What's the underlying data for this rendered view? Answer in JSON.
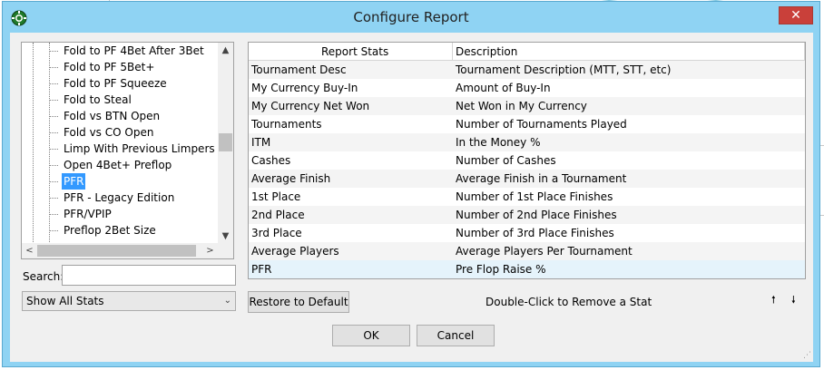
{
  "window": {
    "title": "Configure Report",
    "close_label": "✕"
  },
  "tree": {
    "items": [
      {
        "label": "Fold to PF 4Bet After 3Bet",
        "selected": false
      },
      {
        "label": "Fold to PF 5Bet+",
        "selected": false
      },
      {
        "label": "Fold to PF Squeeze",
        "selected": false
      },
      {
        "label": "Fold to Steal",
        "selected": false
      },
      {
        "label": "Fold vs BTN Open",
        "selected": false
      },
      {
        "label": "Fold vs CO Open",
        "selected": false
      },
      {
        "label": "Limp With Previous Limpers",
        "selected": false
      },
      {
        "label": "Open 4Bet+ Preflop",
        "selected": false
      },
      {
        "label": "PFR",
        "selected": true
      },
      {
        "label": "PFR - Legacy Edition",
        "selected": false
      },
      {
        "label": "PFR/VPIP",
        "selected": false
      },
      {
        "label": "Preflop 2Bet Size",
        "selected": false
      }
    ],
    "scroll_up": "▲",
    "scroll_down": "▼",
    "scroll_left": "<",
    "scroll_right": ">"
  },
  "search": {
    "label": "Search:",
    "value": ""
  },
  "filter": {
    "value": "Show All Stats",
    "arrow": "⌄"
  },
  "table": {
    "columns": [
      "Report Stats",
      "Description"
    ],
    "rows": [
      [
        "Tournament Desc",
        "Tournament Description (MTT, STT, etc)"
      ],
      [
        "My Currency Buy-In",
        "Amount of Buy-In"
      ],
      [
        "My Currency Net Won",
        "Net Won in My Currency"
      ],
      [
        "Tournaments",
        "Number of Tournaments Played"
      ],
      [
        "ITM",
        "In the Money %"
      ],
      [
        "Cashes",
        "Number of Cashes"
      ],
      [
        "Average Finish",
        "Average Finish in a Tournament"
      ],
      [
        "1st Place",
        "Number of 1st Place Finishes"
      ],
      [
        "2nd Place",
        "Number of 2nd Place Finishes"
      ],
      [
        "3rd Place",
        "Number of 3rd Place Finishes"
      ],
      [
        "Average Players",
        "Average Players Per Tournament"
      ],
      [
        "PFR",
        "Pre Flop Raise %"
      ]
    ],
    "selected_row": 11
  },
  "actions": {
    "restore_label": "Restore to Default",
    "hint": "Double-Click to Remove a Stat",
    "move_up": "🠕",
    "move_down": "🠗",
    "ok_label": "OK",
    "cancel_label": "Cancel"
  },
  "colors": {
    "window_frame": "#8fd3f3",
    "close": "#c9403a",
    "selection": "#3399ff"
  }
}
